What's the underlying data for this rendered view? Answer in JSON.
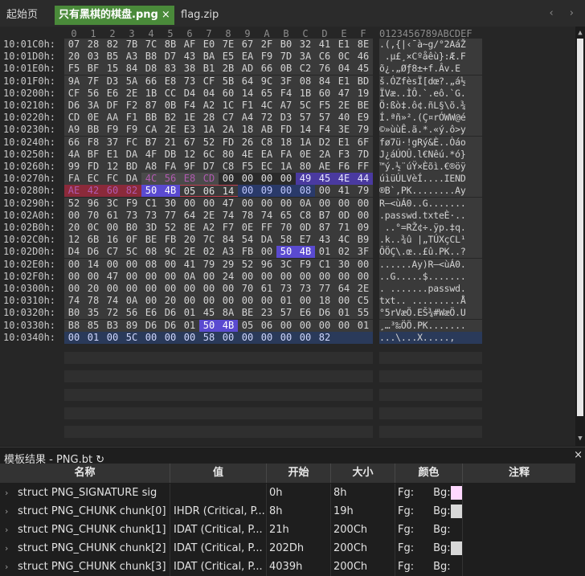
{
  "tabs": [
    {
      "label": "起始页",
      "active": false
    },
    {
      "label": "只有黑棋的棋盘.png",
      "active": true
    },
    {
      "label": "flag.zip",
      "active": false
    }
  ],
  "tab_close_glyph": "×",
  "nav_arrows": "‹ ›",
  "hex": {
    "column_headers": [
      "0",
      "1",
      "2",
      "3",
      "4",
      "5",
      "6",
      "7",
      "8",
      "9",
      "A",
      "B",
      "C",
      "D",
      "E",
      "F"
    ],
    "ascii_header": "0123456789ABCDEF",
    "rows": [
      {
        "addr": "10:01C0h:",
        "bytes": [
          "07",
          "28",
          "82",
          "7B",
          "7C",
          "8B",
          "AF",
          "E0",
          "7E",
          "67",
          "2F",
          "B0",
          "32",
          "41",
          "E1",
          "8E"
        ],
        "ascii": ".(‚{|‹¯à~g/°2AáŽ"
      },
      {
        "addr": "10:01D0h:",
        "bytes": [
          "20",
          "03",
          "B5",
          "A3",
          "B8",
          "D7",
          "43",
          "BA",
          "E5",
          "EA",
          "F9",
          "7D",
          "3A",
          "C6",
          "0C",
          "46"
        ],
        "ascii": " .µ£¸×Cºåêù}:Æ.F"
      },
      {
        "addr": "10:01E0h:",
        "bytes": [
          "F5",
          "BF",
          "15",
          "84",
          "D8",
          "83",
          "38",
          "B1",
          "2B",
          "AD",
          "66",
          "0B",
          "C2",
          "76",
          "04",
          "45"
        ],
        "ascii": "õ¿.„Øƒ8±+­f.Âv.E"
      },
      {
        "addr": "10:01F0h:",
        "bytes": [
          "9A",
          "7F",
          "D3",
          "5A",
          "66",
          "E8",
          "73",
          "CF",
          "5B",
          "64",
          "9C",
          "3F",
          "08",
          "84",
          "E1",
          "BD"
        ],
        "ascii": "š.ÓZfèsÏ[dœ?.„á½"
      },
      {
        "addr": "10:0200h:",
        "bytes": [
          "CF",
          "56",
          "E6",
          "2E",
          "1B",
          "CC",
          "D4",
          "04",
          "60",
          "14",
          "65",
          "F4",
          "1B",
          "60",
          "47",
          "19"
        ],
        "ascii": "ÏVæ..ÌÔ.`.eô.`G."
      },
      {
        "addr": "10:0210h:",
        "bytes": [
          "D6",
          "3A",
          "DF",
          "F2",
          "87",
          "0B",
          "F4",
          "A2",
          "1C",
          "F1",
          "4C",
          "A7",
          "5C",
          "F5",
          "2E",
          "BE"
        ],
        "ascii": "Ö:ßò‡.ô¢.ñL§\\õ.¾"
      },
      {
        "addr": "10:0220h:",
        "bytes": [
          "CD",
          "0E",
          "AA",
          "F1",
          "BB",
          "B2",
          "1E",
          "28",
          "C7",
          "A4",
          "72",
          "D3",
          "57",
          "57",
          "40",
          "E9"
        ],
        "ascii": "Í.ªñ»².(Ç¤rÓWW@é"
      },
      {
        "addr": "10:0230h:",
        "bytes": [
          "A9",
          "BB",
          "F9",
          "F9",
          "CA",
          "2E",
          "E3",
          "1A",
          "2A",
          "18",
          "AB",
          "FD",
          "14",
          "F4",
          "3E",
          "79"
        ],
        "ascii": "©»ùùÊ.ã.*.«ý.ô>y"
      },
      {
        "addr": "10:0240h:",
        "bytes": [
          "66",
          "F8",
          "37",
          "FC",
          "B7",
          "21",
          "67",
          "52",
          "FD",
          "26",
          "C8",
          "18",
          "1A",
          "D2",
          "E1",
          "6F"
        ],
        "ascii": "fø7ü·!gRý&È..Òáo"
      },
      {
        "addr": "10:0250h:",
        "bytes": [
          "4A",
          "BF",
          "E1",
          "DA",
          "4F",
          "DB",
          "12",
          "6C",
          "80",
          "4E",
          "EA",
          "FA",
          "0E",
          "2A",
          "F3",
          "7D"
        ],
        "ascii": "J¿áÚOÛ.l€Nêú.*ó}"
      },
      {
        "addr": "10:0260h:",
        "bytes": [
          "99",
          "FD",
          "12",
          "BD",
          "A8",
          "FA",
          "9F",
          "D7",
          "C8",
          "F5",
          "EC",
          "1A",
          "80",
          "AE",
          "F6",
          "FF"
        ],
        "ascii": "™ý.½¨úŸ×Èõì.€®öÿ"
      },
      {
        "addr": "10:0270h:",
        "bytes": [
          "FA",
          "EC",
          "FC",
          "DA",
          "4C",
          "56",
          "E8",
          "CD",
          "00",
          "00",
          "00",
          "00",
          "49",
          "45",
          "4E",
          "44"
        ],
        "ascii": "úìüÚLVèÍ....IEND"
      },
      {
        "addr": "10:0280h:",
        "bytes": [
          "AE",
          "42",
          "60",
          "82",
          "50",
          "4B",
          "05",
          "06",
          "14",
          "00",
          "09",
          "00",
          "08",
          "00",
          "41",
          "79"
        ],
        "ascii": "®B`‚PK........Ay"
      },
      {
        "addr": "10:0290h:",
        "bytes": [
          "52",
          "96",
          "3C",
          "F9",
          "C1",
          "30",
          "00",
          "00",
          "47",
          "00",
          "00",
          "00",
          "0A",
          "00",
          "00",
          "00"
        ],
        "ascii": "R–<ùÁ0..G......."
      },
      {
        "addr": "10:02A0h:",
        "bytes": [
          "00",
          "70",
          "61",
          "73",
          "73",
          "77",
          "64",
          "2E",
          "74",
          "78",
          "74",
          "65",
          "C8",
          "B7",
          "0D",
          "00"
        ],
        "ascii": ".passwd.txteÈ·.."
      },
      {
        "addr": "10:02B0h:",
        "bytes": [
          "20",
          "0C",
          "00",
          "B0",
          "3D",
          "52",
          "8E",
          "A2",
          "F7",
          "0E",
          "FF",
          "70",
          "0D",
          "87",
          "71",
          "09"
        ],
        "ascii": " ..°=RŽ¢÷.ÿp.‡q."
      },
      {
        "addr": "10:02C0h:",
        "bytes": [
          "12",
          "6B",
          "16",
          "0F",
          "BE",
          "FB",
          "20",
          "7C",
          "84",
          "54",
          "DA",
          "58",
          "E7",
          "43",
          "4C",
          "B9"
        ],
        "ascii": ".k..¾û |„TÚXçCL¹"
      },
      {
        "addr": "10:02D0h:",
        "bytes": [
          "D4",
          "D6",
          "C7",
          "5C",
          "08",
          "9C",
          "2E",
          "02",
          "A3",
          "FB",
          "00",
          "50",
          "4B",
          "01",
          "02",
          "3F"
        ],
        "ascii": "ÔÖÇ\\.œ..£û.PK..?"
      },
      {
        "addr": "10:02E0h:",
        "bytes": [
          "00",
          "14",
          "00",
          "00",
          "08",
          "00",
          "41",
          "79",
          "29",
          "52",
          "96",
          "3C",
          "F9",
          "C1",
          "30",
          "00"
        ],
        "ascii": "......Ay)R–<ùÁ0."
      },
      {
        "addr": "10:02F0h:",
        "bytes": [
          "00",
          "00",
          "47",
          "00",
          "00",
          "00",
          "0A",
          "00",
          "24",
          "00",
          "00",
          "00",
          "00",
          "00",
          "00",
          "00"
        ],
        "ascii": "..G.....$......."
      },
      {
        "addr": "10:0300h:",
        "bytes": [
          "00",
          "20",
          "00",
          "00",
          "00",
          "00",
          "00",
          "00",
          "00",
          "70",
          "61",
          "73",
          "73",
          "77",
          "64",
          "2E"
        ],
        "ascii": ". .......passwd."
      },
      {
        "addr": "10:0310h:",
        "bytes": [
          "74",
          "78",
          "74",
          "0A",
          "00",
          "20",
          "00",
          "00",
          "00",
          "00",
          "00",
          "01",
          "00",
          "18",
          "00",
          "C5"
        ],
        "ascii": "txt.. .........Å"
      },
      {
        "addr": "10:0320h:",
        "bytes": [
          "B0",
          "35",
          "72",
          "56",
          "E6",
          "D6",
          "01",
          "45",
          "8A",
          "BE",
          "23",
          "57",
          "E6",
          "D6",
          "01",
          "55"
        ],
        "ascii": "°5rVæÖ.EŠ¾#WæÖ.U"
      },
      {
        "addr": "10:0330h:",
        "bytes": [
          "B8",
          "85",
          "B3",
          "89",
          "D6",
          "D6",
          "01",
          "50",
          "4B",
          "05",
          "06",
          "00",
          "00",
          "00",
          "00",
          "01"
        ],
        "ascii": "¸…³‰ÖÖ.PK......."
      },
      {
        "addr": "10:0340h:",
        "bytes": [
          "00",
          "01",
          "00",
          "5C",
          "00",
          "00",
          "00",
          "58",
          "00",
          "00",
          "00",
          "00",
          "00",
          "82",
          "",
          ""
        ],
        "ascii": "...\\...X.....‚"
      }
    ]
  },
  "panel": {
    "title": "模板结果 - PNG.bt",
    "refresh_glyph": "↻",
    "close_glyph": "×",
    "columns": [
      "名称",
      "值",
      "开始",
      "大小",
      "颜色",
      "注释"
    ],
    "rows": [
      {
        "name": "struct PNG_SIGNATURE sig",
        "value": "",
        "start": "0h",
        "size": "8h",
        "fg": "Fg:",
        "bg": "Bg:",
        "swatch": "#ffd8ff"
      },
      {
        "name": "struct PNG_CHUNK chunk[0]",
        "value": "IHDR  (Critical, P...",
        "start": "8h",
        "size": "19h",
        "fg": "Fg:",
        "bg": "Bg:",
        "swatch": "#d8d8d8"
      },
      {
        "name": "struct PNG_CHUNK chunk[1]",
        "value": "IDAT  (Critical, P...",
        "start": "21h",
        "size": "200Ch",
        "fg": "Fg:",
        "bg": "Bg:",
        "swatch": ""
      },
      {
        "name": "struct PNG_CHUNK chunk[2]",
        "value": "IDAT  (Critical, P...",
        "start": "202Dh",
        "size": "200Ch",
        "fg": "Fg:",
        "bg": "Bg:",
        "swatch": "#d8d8d8"
      },
      {
        "name": "struct PNG_CHUNK chunk[3]",
        "value": "IDAT  (Critical, P...",
        "start": "4039h",
        "size": "200Ch",
        "fg": "Fg:",
        "bg": "Bg:",
        "swatch": ""
      }
    ]
  },
  "colors": {
    "active_tab": "#4a8a3a",
    "iend_highlight": "#4a3aa0",
    "pk_highlight": "#5a4ad0",
    "end_chunk_highlight": "#8b2a3a",
    "blue_highlight": "#2a3a6a"
  }
}
